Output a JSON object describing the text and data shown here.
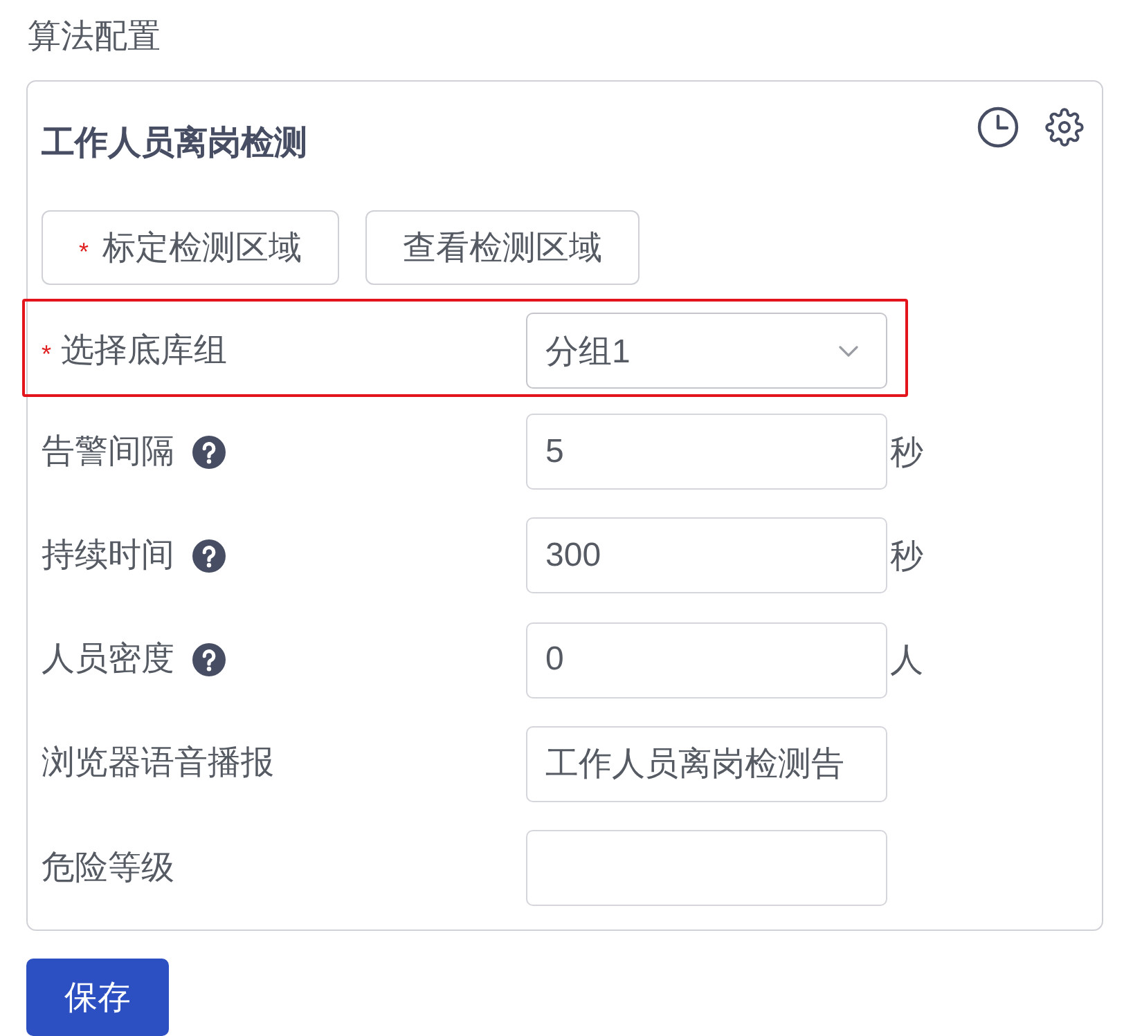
{
  "section_title": "算法配置",
  "card": {
    "title": "工作人员离岗检测",
    "region_buttons": [
      {
        "label": "标定检测区域",
        "required_mark": "*"
      },
      {
        "label": "查看检测区域"
      }
    ],
    "fields": [
      {
        "kind": "select",
        "label": "选择底库组",
        "required_mark": "*",
        "highlighted": true,
        "help": false,
        "value": "分组1"
      },
      {
        "kind": "input",
        "label": "告警间隔",
        "highlighted": false,
        "help": true,
        "value": "5",
        "unit": "秒"
      },
      {
        "kind": "input",
        "label": "持续时间",
        "highlighted": false,
        "help": true,
        "value": "300",
        "unit": "秒"
      },
      {
        "kind": "input",
        "label": "人员密度",
        "highlighted": false,
        "help": true,
        "value": "0",
        "unit": "人"
      },
      {
        "kind": "input",
        "label": "浏览器语音播报",
        "highlighted": false,
        "help": false,
        "value": "工作人员离岗检测告"
      },
      {
        "kind": "input",
        "label": "危险等级",
        "highlighted": false,
        "help": false
      }
    ]
  },
  "save_button": "保存"
}
